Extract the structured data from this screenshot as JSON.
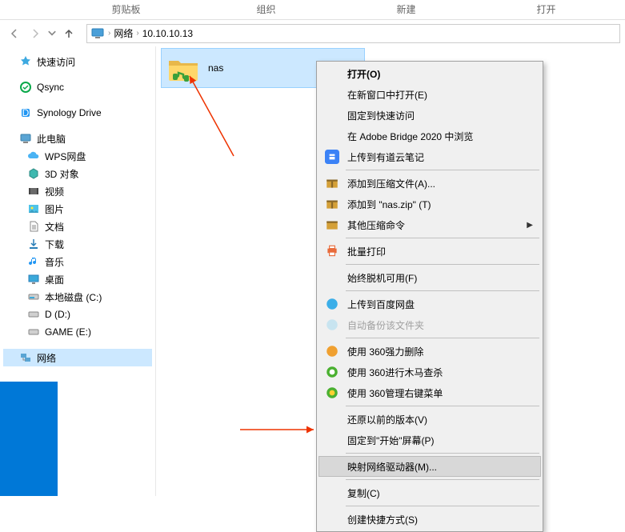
{
  "ribbon": {
    "tabs": [
      "剪贴板",
      "组织",
      "新建",
      "打开"
    ]
  },
  "address": {
    "root": "网络",
    "path": "10.10.10.13"
  },
  "sidebar": {
    "quick": "快速访问",
    "qsync": "Qsync",
    "synology": "Synology Drive",
    "thispc": "此电脑",
    "items": [
      {
        "label": "WPS网盘"
      },
      {
        "label": "3D 对象"
      },
      {
        "label": "视频"
      },
      {
        "label": "图片"
      },
      {
        "label": "文档"
      },
      {
        "label": "下载"
      },
      {
        "label": "音乐"
      },
      {
        "label": "桌面"
      },
      {
        "label": "本地磁盘 (C:)"
      },
      {
        "label": "D (D:)"
      },
      {
        "label": "GAME (E:)"
      }
    ],
    "network": "网络"
  },
  "content": {
    "folders": [
      {
        "name": "nas"
      }
    ]
  },
  "ctx": {
    "open": "打开(O)",
    "newwin": "在新窗口中打开(E)",
    "pin": "固定到快速访问",
    "adobe": "在 Adobe Bridge 2020 中浏览",
    "youdao": "上传到有道云笔记",
    "zip_add": "添加到压缩文件(A)...",
    "zip_nas": "添加到 \"nas.zip\" (T)",
    "zip_other": "其他压缩命令",
    "batch_print": "批量打印",
    "offline": "始终脱机可用(F)",
    "baidu": "上传到百度网盘",
    "autobak": "自动备份该文件夹",
    "del360": "使用 360强力删除",
    "trojan360": "使用 360进行木马查杀",
    "menu360": "使用 360管理右键菜单",
    "restore": "还原以前的版本(V)",
    "pinstart": "固定到\"开始\"屏幕(P)",
    "map": "映射网络驱动器(M)...",
    "copy": "复制(C)",
    "shortcut": "创建快捷方式(S)"
  }
}
